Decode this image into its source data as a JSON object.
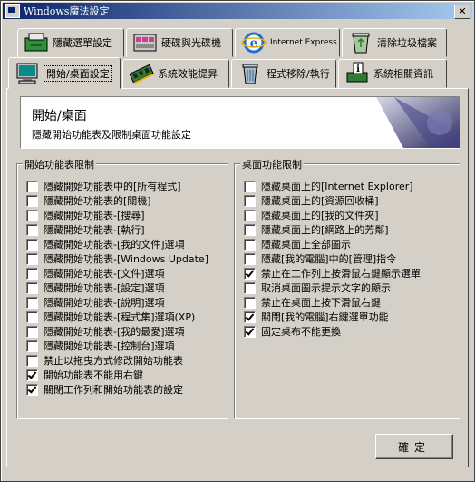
{
  "window": {
    "title": "Windows魔法設定"
  },
  "tabs_row1": [
    {
      "label": "隱藏選單設定",
      "icon": "floppy-drive-icon"
    },
    {
      "label": "硬碟與光碟機",
      "icon": "drives-icon"
    },
    {
      "label": "Internet Express",
      "icon": "internet-explorer-icon"
    },
    {
      "label": "清除垃圾檔案",
      "icon": "recycle-bin-icon"
    }
  ],
  "tabs_row2": [
    {
      "label": "開始/桌面設定",
      "icon": "monitor-icon",
      "active": true
    },
    {
      "label": "系統效能提昇",
      "icon": "memory-chip-icon"
    },
    {
      "label": "程式移除/執行",
      "icon": "trash-can-icon"
    },
    {
      "label": "系統相關資訊",
      "icon": "info-icon"
    }
  ],
  "banner": {
    "title": "開始/桌面",
    "subtitle": "隱藏開始功能表及限制桌面功能設定"
  },
  "start_menu_group": {
    "title": "開始功能表限制",
    "items": [
      {
        "label": "隱藏開始功能表中的[所有程式]",
        "checked": false
      },
      {
        "label": "隱藏開始功能表的[關機]",
        "checked": false
      },
      {
        "label": "隱藏開始功能表-[搜尋]",
        "checked": false
      },
      {
        "label": "隱藏開始功能表-[執行]",
        "checked": false
      },
      {
        "label": "隱藏開始功能表-[我的文件]選項",
        "checked": false
      },
      {
        "label": "隱藏開始功能表-[Windows Update]",
        "checked": false
      },
      {
        "label": "隱藏開始功能表-[文件]選項",
        "checked": false
      },
      {
        "label": "隱藏開始功能表-[設定]選項",
        "checked": false
      },
      {
        "label": "隱藏開始功能表-[說明]選項",
        "checked": false
      },
      {
        "label": "隱藏開始功能表-[程式集]選項(XP)",
        "checked": false
      },
      {
        "label": "隱藏開始功能表-[我的最愛]選項",
        "checked": false
      },
      {
        "label": "隱藏開始功能表-[控制台]選項",
        "checked": false
      },
      {
        "label": "禁止以拖曳方式修改開始功能表",
        "checked": false
      },
      {
        "label": "開始功能表不能用右鍵",
        "checked": true
      },
      {
        "label": "關閉工作列和開始功能表的設定",
        "checked": true
      }
    ]
  },
  "desktop_group": {
    "title": "桌面功能限制",
    "items": [
      {
        "label": "隱藏桌面上的[Internet Explorer]",
        "checked": false
      },
      {
        "label": "隱藏桌面上的[資源回收桶]",
        "checked": false
      },
      {
        "label": "隱藏桌面上的[我的文件夾]",
        "checked": false
      },
      {
        "label": "隱藏桌面上的[網路上的芳鄰]",
        "checked": false
      },
      {
        "label": "隱藏桌面上全部圖示",
        "checked": false
      },
      {
        "label": "隱藏[我的電腦]中的[管理]指令",
        "checked": false
      },
      {
        "label": "禁止在工作列上按滑鼠右鍵顯示選單",
        "checked": true
      },
      {
        "label": "取消桌面圖示提示文字的顯示",
        "checked": false
      },
      {
        "label": "禁止在桌面上按下滑鼠右鍵",
        "checked": false
      },
      {
        "label": "關閉[我的電腦]右鍵選單功能",
        "checked": true
      },
      {
        "label": "固定桌布不能更換",
        "checked": true
      }
    ]
  },
  "buttons": {
    "ok": "確定"
  }
}
